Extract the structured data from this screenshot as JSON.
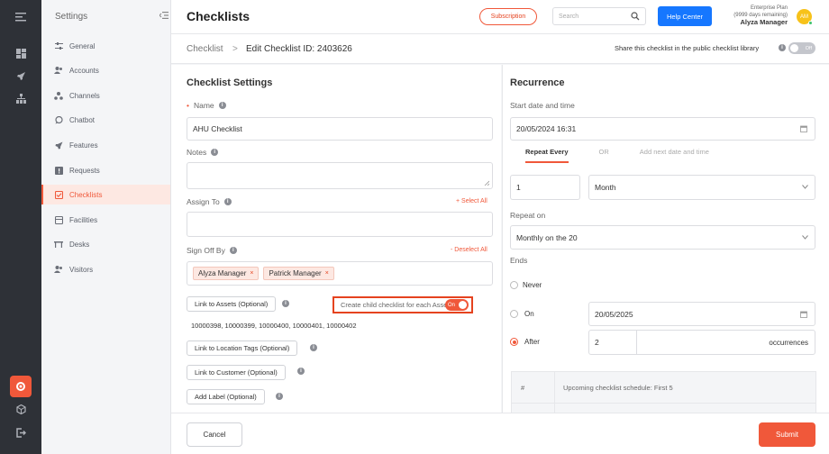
{
  "colors": {
    "accent": "#f0583a",
    "primary": "#1677ff",
    "rail": "#2e3137"
  },
  "sidebar": {
    "header": "Settings",
    "items": [
      {
        "label": "General",
        "icon": "sliders-icon"
      },
      {
        "label": "Accounts",
        "icon": "users-icon"
      },
      {
        "label": "Channels",
        "icon": "channels-icon"
      },
      {
        "label": "Chatbot",
        "icon": "chat-icon"
      },
      {
        "label": "Features",
        "icon": "rocket-icon"
      },
      {
        "label": "Requests",
        "icon": "request-icon"
      },
      {
        "label": "Checklists",
        "icon": "checklist-icon",
        "active": true
      },
      {
        "label": "Facilities",
        "icon": "facilities-icon"
      },
      {
        "label": "Desks",
        "icon": "desk-icon"
      },
      {
        "label": "Visitors",
        "icon": "visitors-icon"
      }
    ]
  },
  "header": {
    "title": "Checklists",
    "subscription_label": "Subscription",
    "search_placeholder": "Search",
    "help_label": "Help Center",
    "plan": "Enterprise Plan",
    "plan_days": "(9999 days remaining)",
    "user_name": "Alyza Manager",
    "avatar_initials": "AM"
  },
  "breadcrumb": {
    "parent": "Checklist",
    "separator": ">",
    "current": "Edit Checklist ID: 2403626",
    "share_label": "Share this checklist in the public checklist library",
    "share_toggle": "Off"
  },
  "settings": {
    "title": "Checklist Settings",
    "name_label": "Name",
    "name_value": "AHU Checklist",
    "notes_label": "Notes",
    "notes_value": "",
    "assign_label": "Assign To",
    "select_all": "+ Select All",
    "signoff_label": "Sign Off By",
    "deselect_all": "- Deselect All",
    "signoff_tags": [
      "Alyza Manager",
      "Patrick Manager"
    ],
    "link_assets": "Link to Assets (Optional)",
    "child_label": "Create child checklist for each Asset",
    "child_toggle": "On",
    "asset_ids": "10000398, 10000399, 10000400, 10000401, 10000402",
    "link_location": "Link to Location Tags (Optional)",
    "link_customer": "Link to Customer (Optional)",
    "add_label": "Add Label (Optional)"
  },
  "recurrence": {
    "title": "Recurrence",
    "start_label": "Start date and time",
    "start_value": "20/05/2024 16:31",
    "tab_repeat": "Repeat Every",
    "tab_or": "OR",
    "tab_add": "Add next date and time",
    "interval_value": "1",
    "unit_value": "Month",
    "repeat_on_label": "Repeat on",
    "repeat_on_value": "Monthly on the 20",
    "ends_label": "Ends",
    "never_label": "Never",
    "on_label": "On",
    "on_date": "20/05/2025",
    "after_label": "After",
    "after_value": "2",
    "occurrences_label": "occurrences",
    "schedule_hash": "#",
    "schedule_title": "Upcoming checklist schedule: First 5"
  },
  "footer": {
    "cancel_label": "Cancel",
    "submit_label": "Submit"
  }
}
